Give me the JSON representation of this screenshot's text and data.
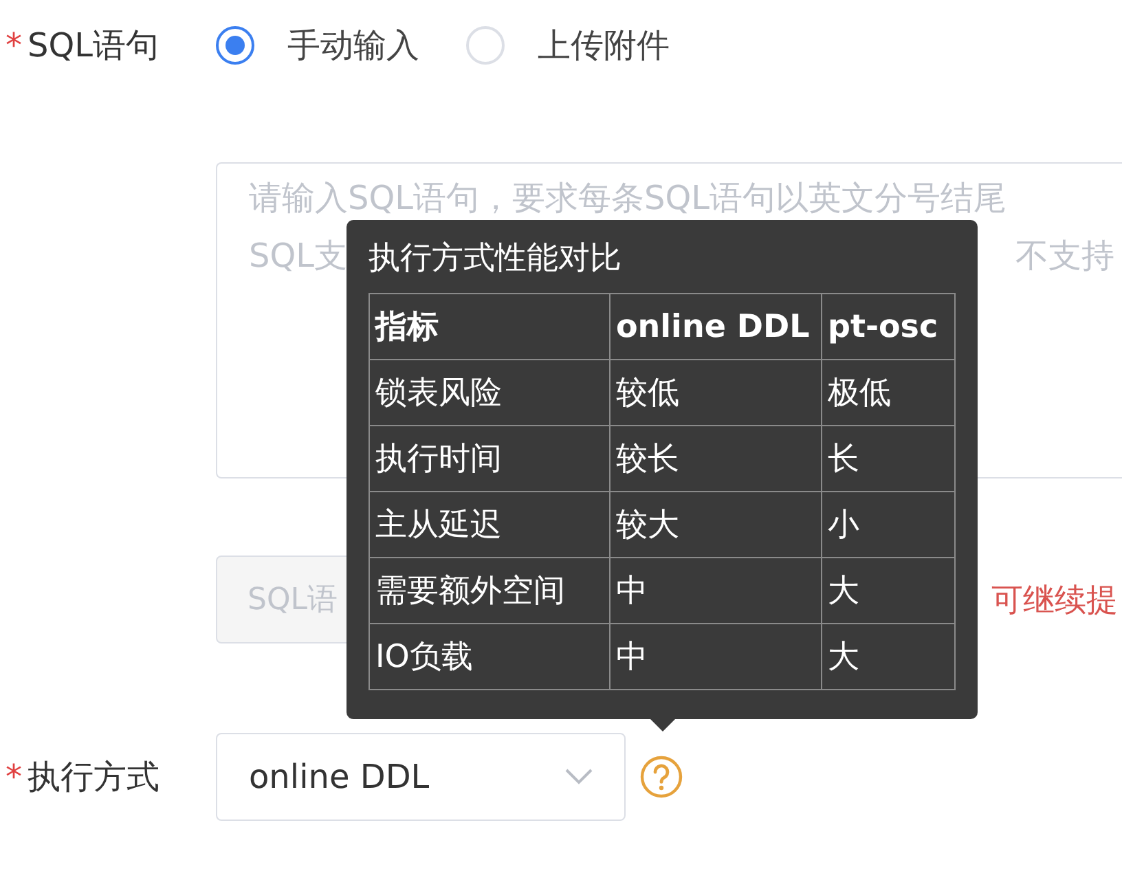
{
  "sql_field": {
    "label": "SQL语句",
    "required_mark": "*",
    "options": [
      {
        "label": "手动输入",
        "selected": true
      },
      {
        "label": "上传附件",
        "selected": false
      }
    ]
  },
  "editor": {
    "lines": [
      {
        "parts": [
          "请输入SQL语句，要求每条SQL语句以英文分号结尾"
        ]
      },
      {
        "parts": [
          "SQL支",
          "不支持"
        ]
      }
    ]
  },
  "check_button": {
    "label": "SQL语"
  },
  "note": "可继续提",
  "mode_field": {
    "label": "执行方式",
    "required_mark": "*",
    "value": "online DDL"
  },
  "tooltip": {
    "title": "执行方式性能对比",
    "columns": [
      "指标",
      "online DDL",
      "pt-osc"
    ],
    "rows": [
      [
        "锁表风险",
        "较低",
        "极低"
      ],
      [
        "执行时间",
        "较长",
        "长"
      ],
      [
        "主从延迟",
        "较大",
        "小"
      ],
      [
        "需要额外空间",
        "中",
        "大"
      ],
      [
        "IO负载",
        "中",
        "大"
      ]
    ]
  }
}
